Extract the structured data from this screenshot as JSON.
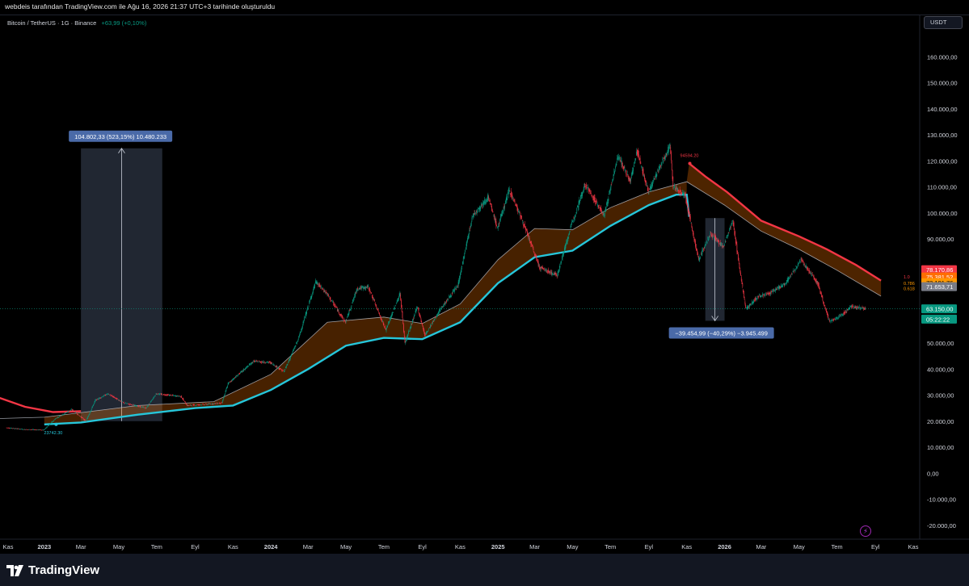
{
  "header": {
    "attribution": "webdeis tarafından TradingView.com ile Ağu 16, 2026 21:37 UTC+3 tarihinde oluşturuldu"
  },
  "symbol": {
    "name": "Bitcoin / TetherUS · 1G · Binance",
    "change": "+63,99 (+0,10%)"
  },
  "currency_button": "USDT",
  "footer": {
    "logo_text": "TradingView"
  },
  "colors": {
    "background": "#000000",
    "bull": "#089981",
    "bear": "#f23645",
    "ema_red": "#f23645",
    "ema_cyan": "#26c6da",
    "band_orange": "#ff9800",
    "measure_box": "#4a5a80"
  },
  "icons": [
    "flash-icon",
    "tradingview-logo-icon"
  ],
  "chart_data": {
    "type": "candlestick",
    "symbol": "BTCUSDT",
    "ylim": [
      -25000,
      170000
    ],
    "y_ticks": [
      {
        "v": 160000,
        "label": "160.000,00"
      },
      {
        "v": 150000,
        "label": "150.000,00"
      },
      {
        "v": 140000,
        "label": "140.000,00"
      },
      {
        "v": 130000,
        "label": "130.000,00"
      },
      {
        "v": 120000,
        "label": "120.000,00"
      },
      {
        "v": 110000,
        "label": "110.000,00"
      },
      {
        "v": 100000,
        "label": "100.000,00"
      },
      {
        "v": 90000,
        "label": "90.000,00"
      },
      {
        "v": 50000,
        "label": "50.000,00"
      },
      {
        "v": 40000,
        "label": "40.000,00"
      },
      {
        "v": 30000,
        "label": "30.000,00"
      },
      {
        "v": 20000,
        "label": "20.000,00"
      },
      {
        "v": 10000,
        "label": "10.000,00"
      },
      {
        "v": 0,
        "label": "0,00"
      },
      {
        "v": -10000,
        "label": "-10.000,00"
      },
      {
        "v": -20000,
        "label": "-20.000,00"
      }
    ],
    "x_ticks": [
      {
        "label": "Kas",
        "date": "2022-11-01"
      },
      {
        "label": "2023",
        "date": "2023-01-01",
        "year": true
      },
      {
        "label": "Mar",
        "date": "2023-03-01"
      },
      {
        "label": "May",
        "date": "2023-05-01"
      },
      {
        "label": "Tem",
        "date": "2023-07-01"
      },
      {
        "label": "Eyl",
        "date": "2023-09-01"
      },
      {
        "label": "Kas",
        "date": "2023-11-01"
      },
      {
        "label": "2024",
        "date": "2024-01-01",
        "year": true
      },
      {
        "label": "Mar",
        "date": "2024-03-01"
      },
      {
        "label": "May",
        "date": "2024-05-01"
      },
      {
        "label": "Tem",
        "date": "2024-07-01"
      },
      {
        "label": "Eyl",
        "date": "2024-09-01"
      },
      {
        "label": "Kas",
        "date": "2024-11-01"
      },
      {
        "label": "2025",
        "date": "2025-01-01",
        "year": true
      },
      {
        "label": "Mar",
        "date": "2025-03-01"
      },
      {
        "label": "May",
        "date": "2025-05-01"
      },
      {
        "label": "Tem",
        "date": "2025-07-01"
      },
      {
        "label": "Eyl",
        "date": "2025-09-01"
      },
      {
        "label": "Kas",
        "date": "2025-11-01"
      },
      {
        "label": "2026",
        "date": "2026-01-01",
        "year": true
      },
      {
        "label": "Mar",
        "date": "2026-03-01"
      },
      {
        "label": "May",
        "date": "2026-05-01"
      },
      {
        "label": "Tem",
        "date": "2026-07-01"
      },
      {
        "label": "Eyl",
        "date": "2026-09-01"
      },
      {
        "label": "Kas",
        "date": "2026-11-01"
      }
    ],
    "price_path": [
      [
        "2022-11-01",
        17500
      ],
      [
        "2022-12-01",
        16800
      ],
      [
        "2023-01-01",
        16600
      ],
      [
        "2023-01-20",
        21000
      ],
      [
        "2023-02-15",
        24500
      ],
      [
        "2023-03-10",
        20000
      ],
      [
        "2023-03-25",
        28000
      ],
      [
        "2023-04-14",
        30500
      ],
      [
        "2023-05-10",
        27000
      ],
      [
        "2023-06-15",
        25000
      ],
      [
        "2023-07-01",
        30500
      ],
      [
        "2023-08-10",
        29500
      ],
      [
        "2023-08-20",
        26000
      ],
      [
        "2023-09-20",
        26500
      ],
      [
        "2023-10-15",
        27000
      ],
      [
        "2023-10-25",
        34500
      ],
      [
        "2023-12-05",
        43000
      ],
      [
        "2024-01-01",
        42500
      ],
      [
        "2024-01-23",
        39000
      ],
      [
        "2024-02-15",
        51500
      ],
      [
        "2024-03-14",
        73500
      ],
      [
        "2024-04-01",
        69000
      ],
      [
        "2024-05-01",
        58000
      ],
      [
        "2024-05-20",
        71000
      ],
      [
        "2024-06-07",
        71500
      ],
      [
        "2024-07-05",
        55000
      ],
      [
        "2024-07-28",
        69000
      ],
      [
        "2024-08-05",
        50000
      ],
      [
        "2024-08-25",
        64000
      ],
      [
        "2024-09-06",
        53000
      ],
      [
        "2024-10-01",
        63000
      ],
      [
        "2024-10-29",
        72000
      ],
      [
        "2024-11-22",
        99000
      ],
      [
        "2024-12-17",
        106000
      ],
      [
        "2025-01-01",
        94000
      ],
      [
        "2025-01-20",
        109000
      ],
      [
        "2025-02-10",
        97000
      ],
      [
        "2025-03-10",
        79000
      ],
      [
        "2025-04-07",
        76000
      ],
      [
        "2025-05-01",
        96000
      ],
      [
        "2025-05-22",
        111000
      ],
      [
        "2025-06-22",
        99000
      ],
      [
        "2025-07-14",
        122000
      ],
      [
        "2025-08-03",
        112000
      ],
      [
        "2025-08-14",
        124000
      ],
      [
        "2025-09-01",
        108000
      ],
      [
        "2025-10-06",
        126000
      ],
      [
        "2025-10-11",
        110000
      ],
      [
        "2025-10-30",
        107000
      ],
      [
        "2025-11-21",
        82000
      ],
      [
        "2025-12-10",
        92000
      ],
      [
        "2025-12-31",
        87000
      ],
      [
        "2026-01-15",
        97000
      ],
      [
        "2026-02-05",
        63000
      ],
      [
        "2026-02-25",
        68000
      ],
      [
        "2026-03-15",
        69000
      ],
      [
        "2026-04-10",
        73000
      ],
      [
        "2026-05-05",
        82000
      ],
      [
        "2026-06-01",
        73000
      ],
      [
        "2026-06-20",
        58000
      ],
      [
        "2026-07-05",
        60000
      ],
      [
        "2026-07-25",
        64000
      ],
      [
        "2026-08-16",
        63150
      ]
    ],
    "ema_red": [
      [
        "2022-10-20",
        29000
      ],
      [
        "2022-12-01",
        25500
      ],
      [
        "2023-01-15",
        23500
      ],
      [
        "2023-03-01",
        23800
      ],
      [
        "2025-11-05",
        119000
      ],
      [
        "2025-12-01",
        114000
      ],
      [
        "2026-01-05",
        108000
      ],
      [
        "2026-03-01",
        97000
      ],
      [
        "2026-05-01",
        91000
      ],
      [
        "2026-06-15",
        86000
      ],
      [
        "2026-08-01",
        80000
      ],
      [
        "2026-09-10",
        74000
      ]
    ],
    "ema_cyan": [
      [
        "2023-01-01",
        18742
      ],
      [
        "2023-03-01",
        19500
      ],
      [
        "2023-06-01",
        22500
      ],
      [
        "2023-09-01",
        25000
      ],
      [
        "2023-11-01",
        26000
      ],
      [
        "2024-01-01",
        32000
      ],
      [
        "2024-03-01",
        40000
      ],
      [
        "2024-05-01",
        49000
      ],
      [
        "2024-07-01",
        52000
      ],
      [
        "2024-09-01",
        51500
      ],
      [
        "2024-11-01",
        58000
      ],
      [
        "2025-01-01",
        73000
      ],
      [
        "2025-03-01",
        83000
      ],
      [
        "2025-05-01",
        85500
      ],
      [
        "2025-07-01",
        95000
      ],
      [
        "2025-09-01",
        103000
      ],
      [
        "2025-10-15",
        107000
      ],
      [
        "2025-11-01",
        107000
      ],
      [
        "2025-11-05",
        98500
      ]
    ],
    "ribbon_white": [
      [
        "2022-10-20",
        21000
      ],
      [
        "2023-01-01",
        21500
      ],
      [
        "2023-06-01",
        26000
      ],
      [
        "2023-10-01",
        27500
      ],
      [
        "2024-01-01",
        38000
      ],
      [
        "2024-04-01",
        58000
      ],
      [
        "2024-07-01",
        60000
      ],
      [
        "2024-09-01",
        57500
      ],
      [
        "2024-11-01",
        65000
      ],
      [
        "2025-01-01",
        82000
      ],
      [
        "2025-03-01",
        94000
      ],
      [
        "2025-05-01",
        93500
      ],
      [
        "2025-07-01",
        102000
      ],
      [
        "2025-09-01",
        108000
      ],
      [
        "2025-11-01",
        112000
      ],
      [
        "2026-01-01",
        103000
      ],
      [
        "2026-03-01",
        93000
      ],
      [
        "2026-05-01",
        86000
      ],
      [
        "2026-07-01",
        78000
      ],
      [
        "2026-09-10",
        68000
      ]
    ],
    "measurements": [
      {
        "from_date": "2023-03-01",
        "to_date": "2023-07-10",
        "from_price": 20000,
        "to_price": 124802,
        "label": "104.802,33 (523,15%) 10.480.233",
        "direction": "up"
      },
      {
        "from_date": "2025-12-01",
        "to_date": "2026-01-01",
        "from_price": 98000,
        "to_price": 58545,
        "label": "−39.454,99 (−40,29%) −3.945.499",
        "direction": "down"
      }
    ],
    "annotations": [
      {
        "text": "23742.30",
        "date": "2023-01-20",
        "price": 18742,
        "color": "#26c6da"
      },
      {
        "text": "94594.20",
        "date": "2025-11-06",
        "price": 119000,
        "color": "#f23645"
      }
    ],
    "fib_labels": [
      {
        "text": "1.0",
        "price": 75500,
        "color": "#f23645"
      },
      {
        "text": "0.786",
        "price": 73000,
        "color": "#ff9800"
      },
      {
        "text": "0.618",
        "price": 71000,
        "color": "#ff9800"
      }
    ],
    "price_tags": [
      {
        "text": "78.170,86",
        "price": 78170,
        "bg": "#f23645",
        "fg": "#ffffff"
      },
      {
        "text": "75.381,52",
        "price": 75381,
        "bg": "#ff6d00",
        "fg": "#ffffff"
      },
      {
        "text": "73.191,76",
        "price": 73191,
        "bg": "#ff9800",
        "fg": "#000000"
      },
      {
        "text": "71.653,71",
        "price": 71653,
        "bg": "#787b86",
        "fg": "#ffffff"
      },
      {
        "text": "63.150,00",
        "price": 63150,
        "bg": "#089981",
        "fg": "#ffffff"
      },
      {
        "text": "05:22:22",
        "price": 59200,
        "bg": "#089981",
        "fg": "#ffffff"
      }
    ],
    "last_price": 63150
  }
}
